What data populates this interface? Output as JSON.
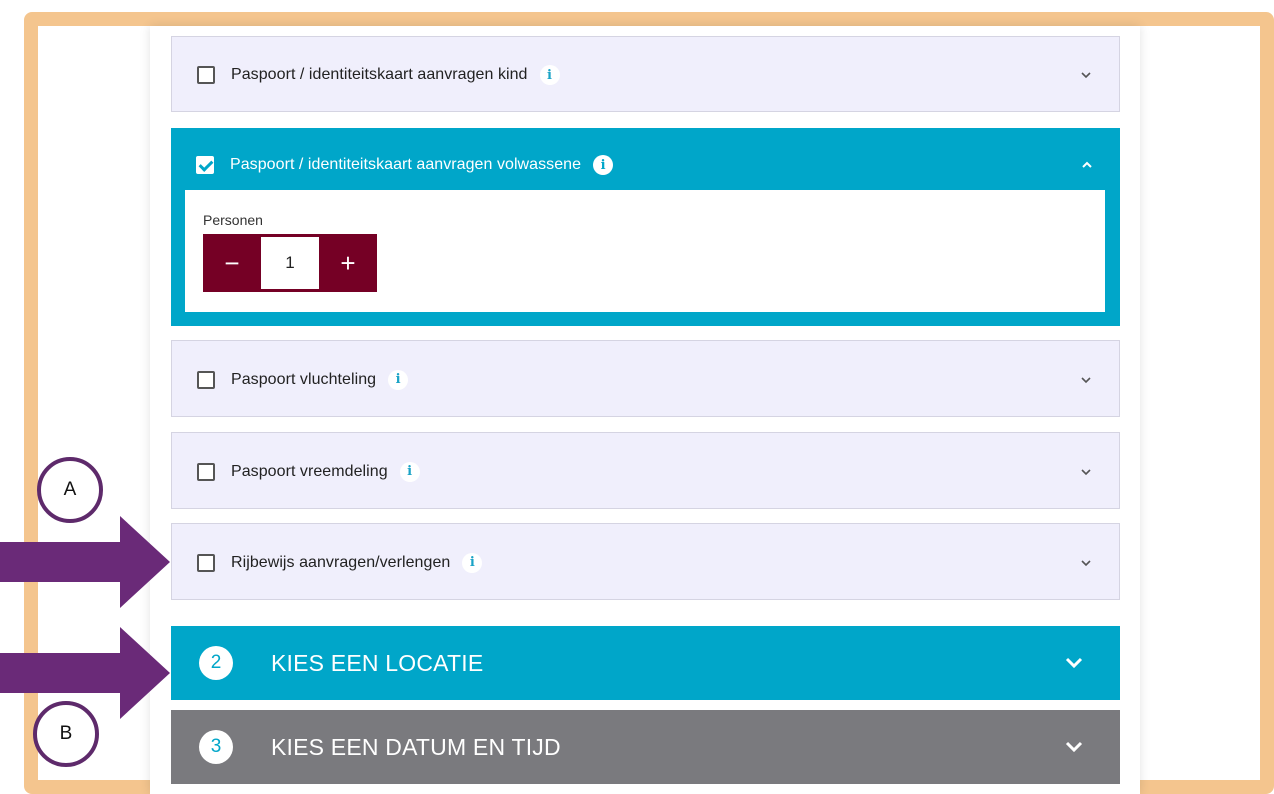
{
  "items": [
    {
      "label": "Paspoort / identiteitskaart aanvragen kind",
      "info": "i",
      "checked": false
    },
    {
      "label": "Paspoort / identiteitskaart aanvragen volwassene",
      "info": "i",
      "checked": true
    },
    {
      "label": "Paspoort vluchteling",
      "info": "i",
      "checked": false
    },
    {
      "label": "Paspoort vreemdeling",
      "info": "i",
      "checked": false
    },
    {
      "label": "Rijbewijs aanvragen/verlengen",
      "info": "i",
      "checked": false
    }
  ],
  "stepper": {
    "label": "Personen",
    "minus": "−",
    "value": "1",
    "plus": "+"
  },
  "sections": [
    {
      "number": "2",
      "title": "KIES EEN LOCATIE"
    },
    {
      "number": "3",
      "title": "KIES EEN DATUM EN TIJD"
    }
  ],
  "annotations": {
    "a": "A",
    "b": "B"
  },
  "colors": {
    "accent": "#00a6c9",
    "stepper": "#750025",
    "frame": "#f4c58e",
    "arrow": "#6a2a78",
    "item_bg": "#f0effc",
    "grey_section": "#7a7a7e"
  },
  "icons": {
    "info": "info-icon",
    "chevron": "chevron-down-icon",
    "check": "checkbox-check-icon"
  }
}
